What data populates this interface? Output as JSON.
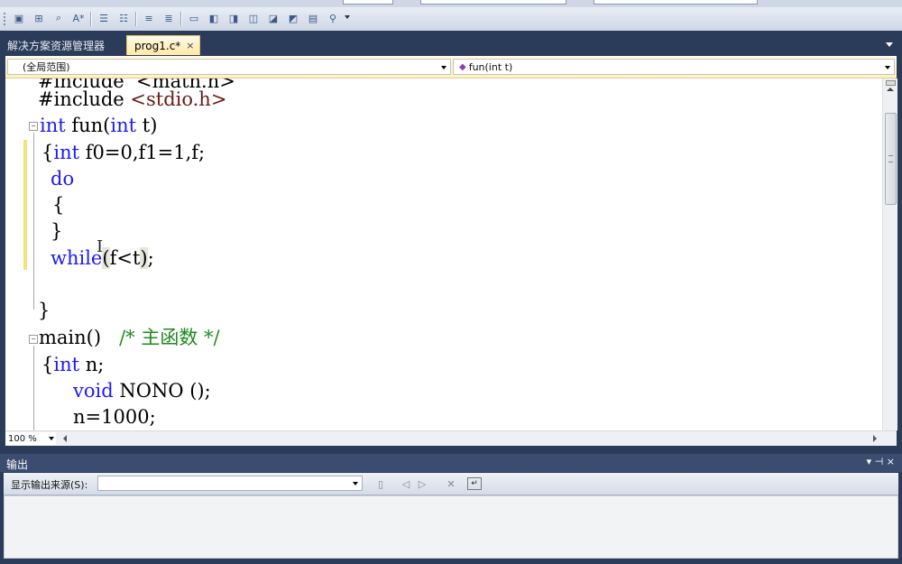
{
  "toolbar": {
    "icons": [
      "properties-icon",
      "class-view-icon",
      "find-symbol-icon",
      "font-size-icon",
      "indent-icon",
      "outdent-icon",
      "comment-icon",
      "uncomment-icon",
      "bookmark-icon",
      "prev-bookmark-icon",
      "next-bookmark-icon",
      "prev-folder-bookmark-icon",
      "next-folder-bookmark-icon",
      "clear-bookmarks-icon",
      "find-icon"
    ],
    "font_glyph": "A*"
  },
  "tabs": {
    "solution_explorer": "解决方案资源管理器",
    "file": "prog1.c*",
    "close_glyph": "×"
  },
  "navigation": {
    "scope": "(全局范围)",
    "function": "fun(int t)"
  },
  "code": {
    "line0": "#include  <math.h>",
    "line1_a": "#include ",
    "line1_b": "<stdio.h>",
    "line2_kw": "int",
    "line2_b": " fun(",
    "line2_kw2": "int",
    "line2_c": " t)",
    "line3_a": "{",
    "line3_kw": "int",
    "line3_b": " f0=0,f1=1,f;",
    "line4_kw": "do",
    "line5": "{",
    "line6": "}",
    "line7_kw": "while",
    "line7_a": "(",
    "line7_b": "f<t",
    "line7_c": ")",
    "line7_d": ";",
    "line9": "}",
    "line10_a": "main()",
    "line10_cm": "/* 主函数 */",
    "line11_a": "{",
    "line11_kw": "int",
    "line11_b": " n;",
    "line12_kw": "void",
    "line12_b": " NONO ();",
    "line13": "n=1000;"
  },
  "zoom": {
    "value": "100 %"
  },
  "output": {
    "title": "输出",
    "source_label": "显示输出来源(S):",
    "source_value": "",
    "pin_glyph": "▾ ⊣ ×"
  },
  "colors": {
    "keyword": "#1a1aff",
    "comment": "#1e8a1e",
    "chrome": "#2b3b5a",
    "tab_active": "#ffe8a6"
  }
}
